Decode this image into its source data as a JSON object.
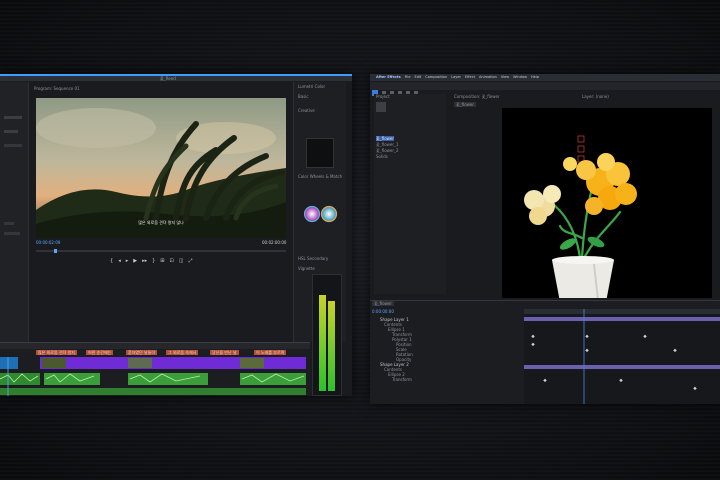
{
  "premiere": {
    "doc_title": "풀_Reed",
    "program_label": "Program: Sequence 01",
    "subtitle": "많은 외로움 견뎌 왔지 않나",
    "timecode_in": "00:00:02:09",
    "timecode_out": "00:02:00:00",
    "fit": "Fit",
    "lumetri": {
      "title": "Lumetri Color",
      "tab_basic": "Basic",
      "tab_creative": "Creative",
      "section_color_wheels": "Color Wheels & Match",
      "section_hsl": "HSL Secondary",
      "section_vignette": "Vignette"
    },
    "caption_texts": [
      "많은 외로움 견뎌 왔지",
      "어떤 순간에는",
      "혼자였던 날들이",
      "그 외로움 속에서",
      "당신을 만난 날",
      "이 노래를 부르며"
    ],
    "transport_glyphs": [
      "{",
      "◂",
      "▸",
      "▶",
      "▸▸",
      "}",
      "⊞",
      "⊡",
      "◫",
      "⤢"
    ]
  },
  "after_effects": {
    "menu": [
      "After Effects",
      "File",
      "Edit",
      "Composition",
      "Layer",
      "Effect",
      "Animation",
      "View",
      "Window",
      "Help"
    ],
    "project_label": "Project",
    "comp_tab": "Composition: 꽃_flower",
    "layer_tab": "Layer: (none)",
    "comp_name": "꽃_flower",
    "project_items": [
      "꽃_flower",
      "꽃_flower_1",
      "꽃_flower_2",
      "Solids"
    ],
    "zoom": "Full",
    "timeline_tab": "꽃_flower",
    "timeline_timecode": "0:00:00:00",
    "layers": [
      "Shape Layer 1",
      "Contents",
      "Ellipse 1",
      "Transform",
      "Polystar 1",
      "Position",
      "Scale",
      "Rotation",
      "Opacity",
      "Shape Layer 2",
      "Contents",
      "Ellipse 2",
      "Transform"
    ]
  },
  "colors": {
    "premiere_accent": "#3aa0ff",
    "video_clip": "#6f2bd6",
    "audio_clip": "#3b9e3b",
    "caption_clip": "#b0503a",
    "flower_orange": "#f7b21a",
    "pot_white": "#eceae4",
    "leaf_green": "#3aa84a"
  }
}
